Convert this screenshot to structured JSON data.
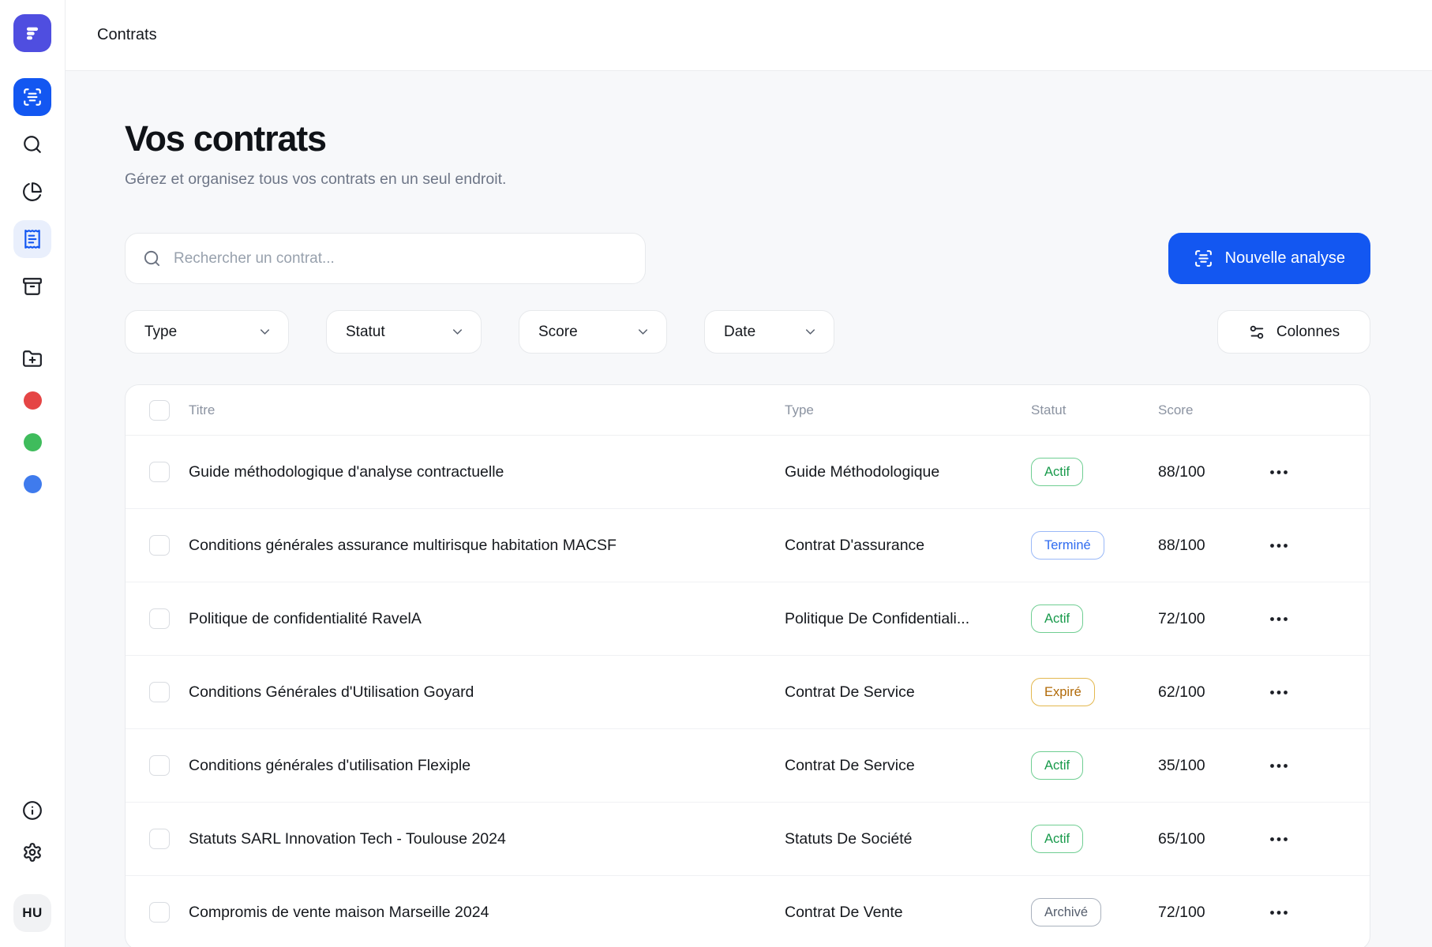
{
  "app": {
    "primary_color": "#1357f1",
    "brand_color": "#4f4ee0"
  },
  "topbar": {
    "title": "Contrats"
  },
  "sidebar": {
    "items": [
      {
        "name": "app-logo",
        "icon": "brand-logo"
      },
      {
        "name": "nav-scan",
        "icon": "scan-text-icon",
        "active": true
      },
      {
        "name": "nav-search",
        "icon": "search-icon"
      },
      {
        "name": "nav-analytics",
        "icon": "pie-chart-icon"
      },
      {
        "name": "nav-contracts",
        "icon": "receipt-icon",
        "active_light": true
      },
      {
        "name": "nav-archive",
        "icon": "archive-icon"
      },
      {
        "name": "nav-new-folder",
        "icon": "folder-plus-icon"
      },
      {
        "name": "status-dot-red",
        "color": "#e54545"
      },
      {
        "name": "status-dot-green",
        "color": "#3fbc5c"
      },
      {
        "name": "status-dot-blue",
        "color": "#3f7bed"
      },
      {
        "name": "nav-info",
        "icon": "info-icon"
      },
      {
        "name": "nav-settings",
        "icon": "gear-icon"
      }
    ],
    "avatar_initials": "HU"
  },
  "page": {
    "title": "Vos contrats",
    "subtitle": "Gérez et organisez tous vos contrats en un seul endroit."
  },
  "search": {
    "placeholder": "Rechercher un contrat..."
  },
  "actions": {
    "new_analysis": "Nouvelle analyse",
    "columns": "Colonnes"
  },
  "filters": [
    {
      "label": "Type"
    },
    {
      "label": "Statut"
    },
    {
      "label": "Score"
    },
    {
      "label": "Date"
    }
  ],
  "table": {
    "columns": {
      "title": "Titre",
      "type": "Type",
      "status": "Statut",
      "score": "Score"
    },
    "status_colors": {
      "green": {
        "text": "#189a4b",
        "border": "#6fce92"
      },
      "blue": {
        "text": "#2f6bf0",
        "border": "#9ab9f8"
      },
      "amber": {
        "text": "#b16a08",
        "border": "#e3b84f"
      },
      "gray": {
        "text": "#555e6d",
        "border": "#a9b1bd"
      }
    },
    "rows": [
      {
        "title": "Guide méthodologique d'analyse contractuelle",
        "type": "Guide Méthodologique",
        "status": "Actif",
        "status_variant": "green",
        "score": "88/100"
      },
      {
        "title": "Conditions générales assurance multirisque habitation MACSF",
        "type": "Contrat D'assurance",
        "status": "Terminé",
        "status_variant": "blue",
        "score": "88/100"
      },
      {
        "title": "Politique de confidentialité RavelA",
        "type": "Politique De Confidentiali...",
        "status": "Actif",
        "status_variant": "green",
        "score": "72/100"
      },
      {
        "title": "Conditions Générales d'Utilisation Goyard",
        "type": "Contrat De Service",
        "status": "Expiré",
        "status_variant": "amber",
        "score": "62/100"
      },
      {
        "title": "Conditions générales d'utilisation Flexiple",
        "type": "Contrat De Service",
        "status": "Actif",
        "status_variant": "green",
        "score": "35/100"
      },
      {
        "title": "Statuts SARL Innovation Tech - Toulouse 2024",
        "type": "Statuts De Société",
        "status": "Actif",
        "status_variant": "green",
        "score": "65/100"
      },
      {
        "title": "Compromis de vente maison Marseille 2024",
        "type": "Contrat De Vente",
        "status": "Archivé",
        "status_variant": "gray",
        "score": "72/100"
      }
    ]
  }
}
